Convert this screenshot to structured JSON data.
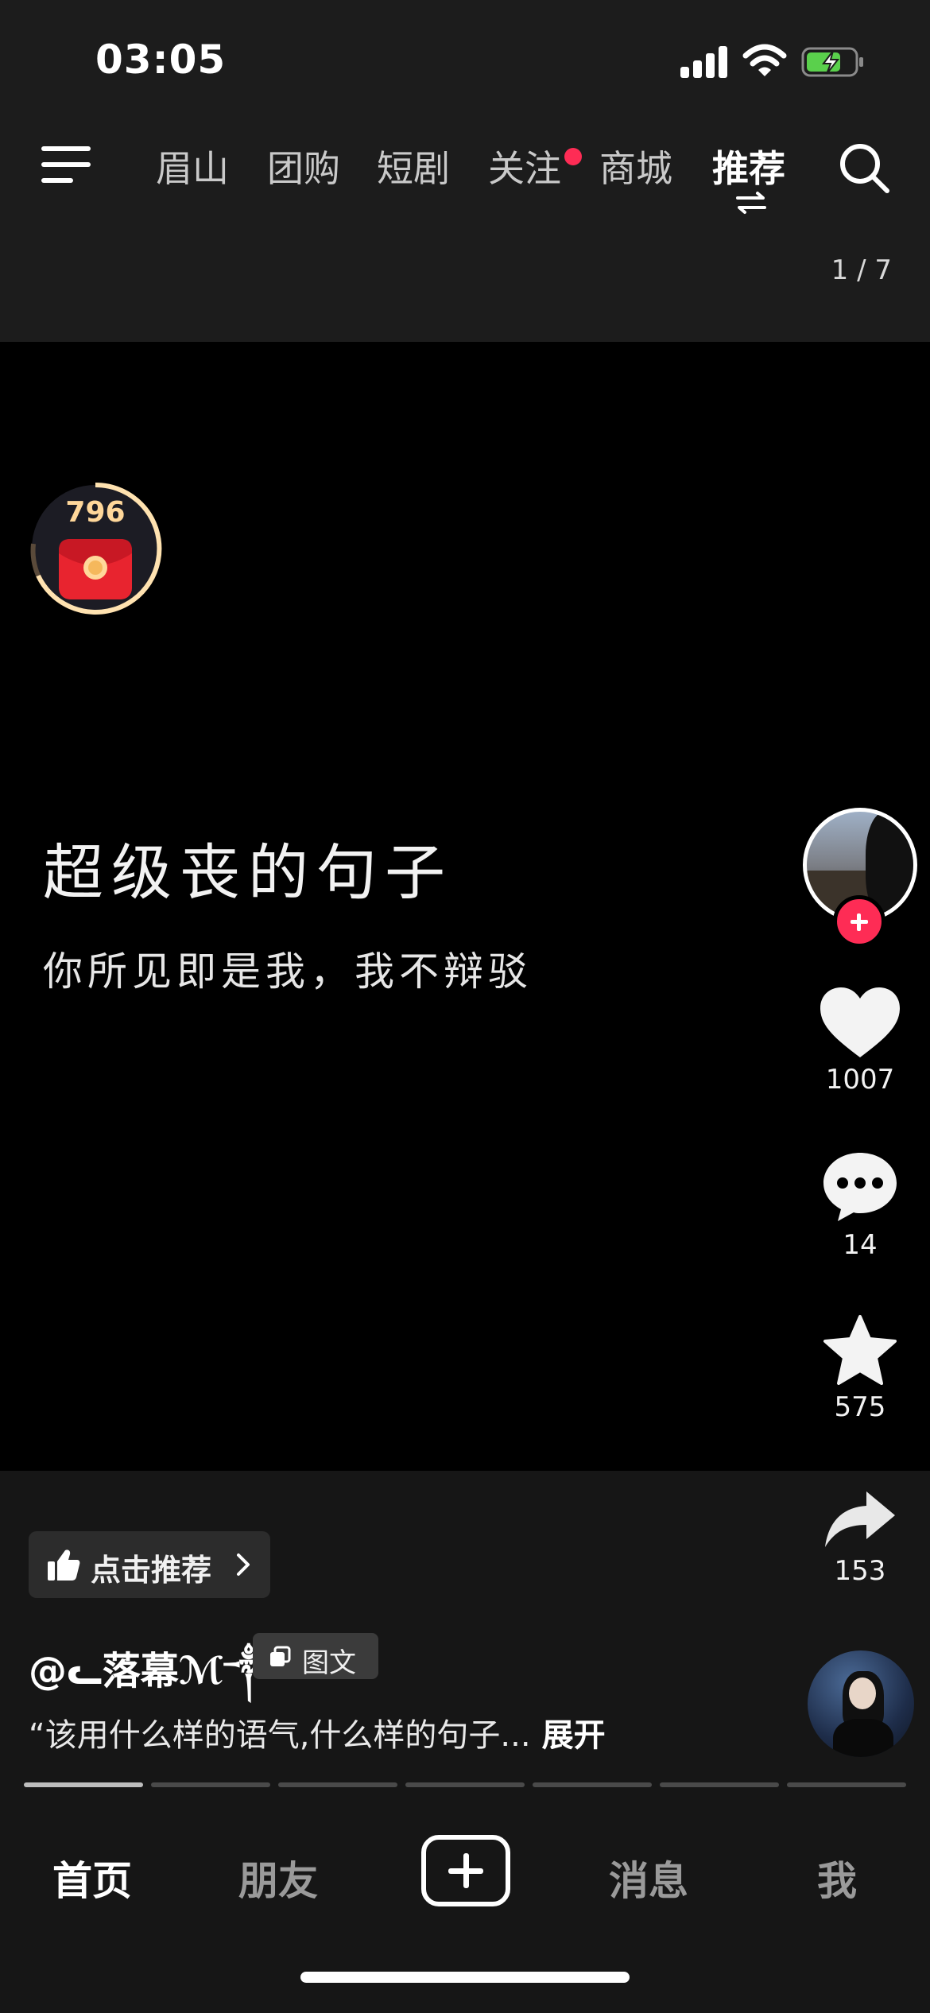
{
  "status_bar": {
    "time": "03:05"
  },
  "top_nav": {
    "tabs": [
      {
        "label": "眉山",
        "active": false
      },
      {
        "label": "团购",
        "active": false
      },
      {
        "label": "短剧",
        "active": false
      },
      {
        "label": "关注",
        "active": false,
        "has_dot": true
      },
      {
        "label": "商城",
        "active": false
      },
      {
        "label": "推荐",
        "active": true
      }
    ],
    "page_counter": "1 / 7"
  },
  "reward": {
    "count": "796"
  },
  "content": {
    "title": "超级丧的句子",
    "subtitle": "你所见即是我，我不辩驳"
  },
  "rail": {
    "likes": "1007",
    "comments": "14",
    "favorites": "575",
    "shares": "153"
  },
  "info": {
    "recommend_label": "点击推荐",
    "username": "@ᓚ落幕ℳ༒",
    "type_badge": "图文",
    "caption": "“该用什么样的语气,什么样的句子...",
    "expand_label": "展开"
  },
  "progress": {
    "total": 7,
    "current": 1
  },
  "bottom_nav": {
    "home": "首页",
    "friends": "朋友",
    "messages": "消息",
    "me": "我"
  },
  "colors": {
    "accent": "#fe2c55",
    "background": "#000000",
    "bar": "#1c1c1c"
  },
  "icons": [
    "menu-icon",
    "search-icon",
    "swap-icon",
    "heart-icon",
    "comment-icon",
    "star-icon",
    "share-icon",
    "thumbs-up-icon",
    "chevron-right-icon",
    "gallery-icon",
    "plus-icon"
  ]
}
